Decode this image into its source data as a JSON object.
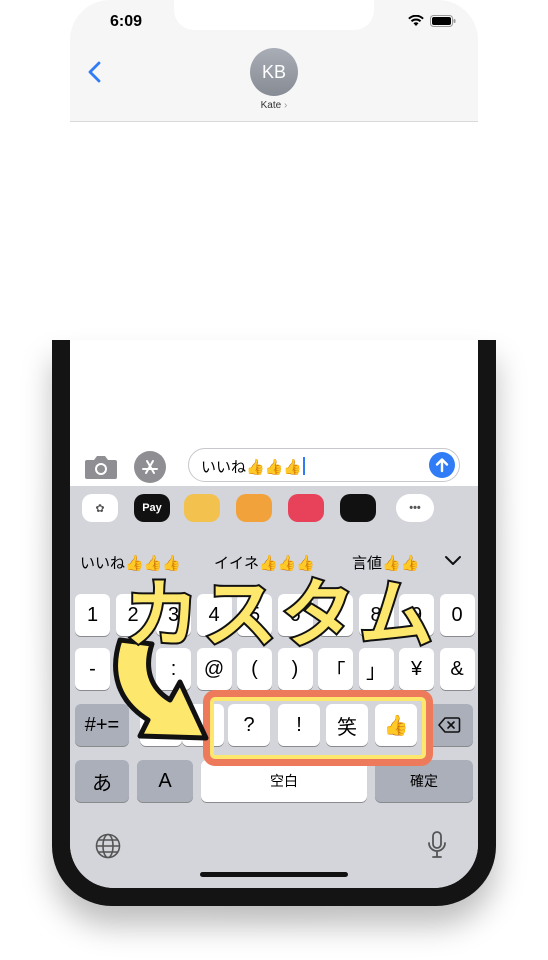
{
  "status_bar": {
    "time": "6:09"
  },
  "conversation": {
    "avatar_initials": "KB",
    "contact_name": "Kate",
    "contact_chevron": "›"
  },
  "composer": {
    "message_text": "いいね👍👍👍"
  },
  "app_strip": [
    {
      "name": "photos-app-icon",
      "label": "✿",
      "color": "#ffffff"
    },
    {
      "name": "applepay-app-icon",
      "label": "Pay",
      "color": "#111111"
    },
    {
      "name": "memoji-app-icon",
      "label": "",
      "color": "#f2c14e"
    },
    {
      "name": "animoji-app-icon",
      "label": "",
      "color": "#f2a23a"
    },
    {
      "name": "search-images-app-icon",
      "label": "",
      "color": "#e8415a"
    },
    {
      "name": "digital-touch-app-icon",
      "label": "",
      "color": "#111111"
    },
    {
      "name": "more-apps-icon",
      "label": "•••",
      "color": "#ffffff"
    }
  ],
  "candidates": [
    "いいね👍👍👍",
    "イイネ👍👍👍",
    "言値👍👍"
  ],
  "keyboard": {
    "row1": [
      "1",
      "2",
      "3",
      "4",
      "5",
      "6",
      "7",
      "8",
      "9",
      "0"
    ],
    "row2": [
      "-",
      "/",
      ":",
      "@",
      "(",
      ")",
      "「",
      "」",
      "¥",
      "&"
    ],
    "row3_left": "#+=",
    "row3_mid": [
      "。",
      "、",
      "?",
      "!",
      "笑",
      "👍"
    ],
    "row4": {
      "kana": "あ",
      "alpha": "A",
      "space": "空白",
      "confirm": "確定"
    }
  },
  "overlay": {
    "title": "カスタム"
  },
  "colors": {
    "accent": "#2f7cf6",
    "highlight_border": "#ee7a5c",
    "highlight_yellow": "#fde76d"
  }
}
